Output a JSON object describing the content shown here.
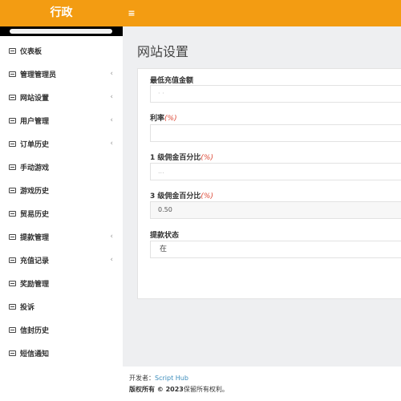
{
  "header": {
    "brand": "行政",
    "menu_toggle_icon": "≡"
  },
  "sidebar": {
    "items": [
      {
        "label": "仪表板",
        "has_submenu": false
      },
      {
        "label": "管理管理员",
        "has_submenu": true
      },
      {
        "label": "网站设置",
        "has_submenu": true
      },
      {
        "label": "用户管理",
        "has_submenu": true
      },
      {
        "label": "订单历史",
        "has_submenu": true
      },
      {
        "label": "手动游戏",
        "has_submenu": false
      },
      {
        "label": "游戏历史",
        "has_submenu": false
      },
      {
        "label": "贸易历史",
        "has_submenu": false
      },
      {
        "label": "提款管理",
        "has_submenu": true
      },
      {
        "label": "充值记录",
        "has_submenu": true
      },
      {
        "label": "奖励管理",
        "has_submenu": false
      },
      {
        "label": "投诉",
        "has_submenu": false
      },
      {
        "label": "信封历史",
        "has_submenu": false
      },
      {
        "label": "短信通知",
        "has_submenu": false
      }
    ],
    "caret": "‹"
  },
  "main": {
    "title": "网站设置",
    "form": {
      "min_recharge": {
        "label": "最低充值金额",
        "value": "·          ·"
      },
      "interest": {
        "label": "利率",
        "unit": "(%)",
        "value": ""
      },
      "commission_1": {
        "label": "1 级佣金百分比",
        "unit": "(%)",
        "value": "..."
      },
      "commission_3": {
        "label": "3 级佣金百分比",
        "unit": "(%)",
        "value": "0.50"
      },
      "withdraw_status": {
        "label": "提款状态",
        "value": "在"
      }
    }
  },
  "footer": {
    "developer_prefix": "开发者：",
    "developer_link": "Script Hub",
    "copyright_bold": "版权所有 © 2023",
    "copyright_rest": "保留所有权利。"
  },
  "colors": {
    "header_bg": "#f39c12",
    "link": "#3c8dbc",
    "required_unit": "#dd4b39"
  }
}
